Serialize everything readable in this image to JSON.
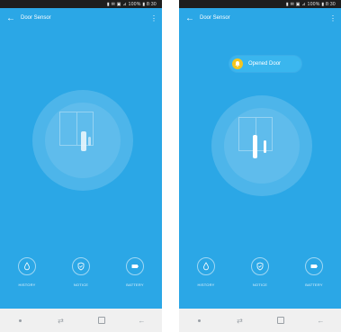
{
  "status_bar": {
    "text": "▮ ✉ ▣ ⊿ 100% ▮ 8:30"
  },
  "app": {
    "title": "Door Sensor"
  },
  "notification": {
    "text": "Opened Door"
  },
  "bottom": {
    "history_label": "HISTORY",
    "notice_label": "NOTICE",
    "battery_label": "BATTERY"
  },
  "colors": {
    "background": "#2ba7e6",
    "bell": "#f5c61e",
    "status_bar": "#1e1e1e",
    "nav_bar": "#f0f0f0"
  },
  "icons": {
    "back": "arrow-left-icon",
    "more": "more-vert-icon",
    "history": "droplet-icon",
    "notice": "shield-icon",
    "battery": "battery-icon",
    "bell": "bell-icon"
  }
}
